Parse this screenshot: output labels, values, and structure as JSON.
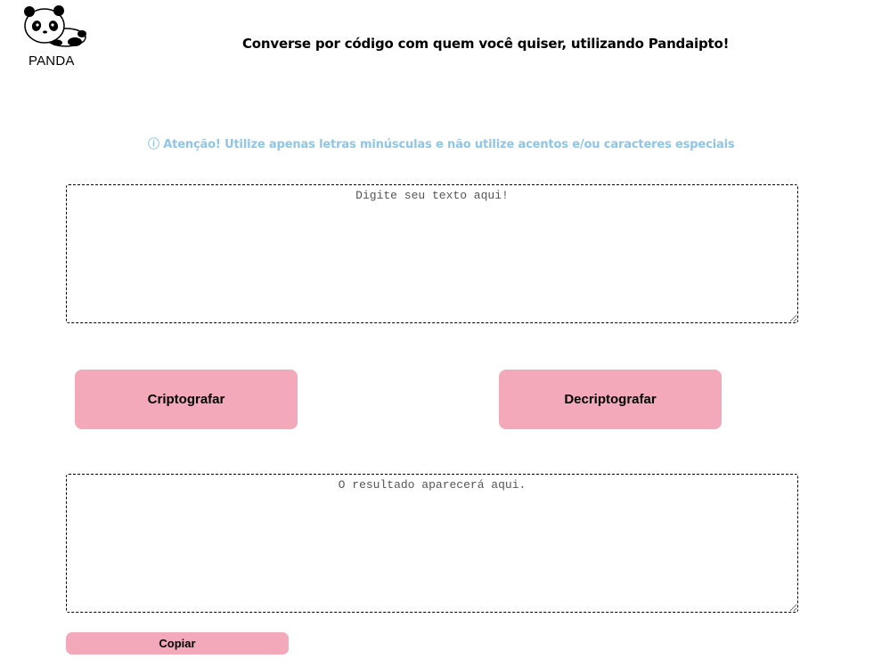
{
  "header": {
    "logo_text": "PANDA",
    "logo_icon": "panda-logo-icon",
    "tagline": "Converse por código com quem você quiser, utilizando Pandaipto!"
  },
  "warning": {
    "text": "ⓘ Atenção! Utilize apenas letras minúsculas e não utilize acentos e/ou caracteres especiais",
    "color": "#8ec5ea"
  },
  "input": {
    "placeholder": "Digite seu texto aqui!",
    "value": ""
  },
  "buttons": {
    "encrypt_label": "Criptografar",
    "decrypt_label": "Decriptografar",
    "copy_label": "Copiar",
    "color": "#f3a9b9"
  },
  "output": {
    "placeholder": "O resultado aparecerá aqui.",
    "value": ""
  }
}
